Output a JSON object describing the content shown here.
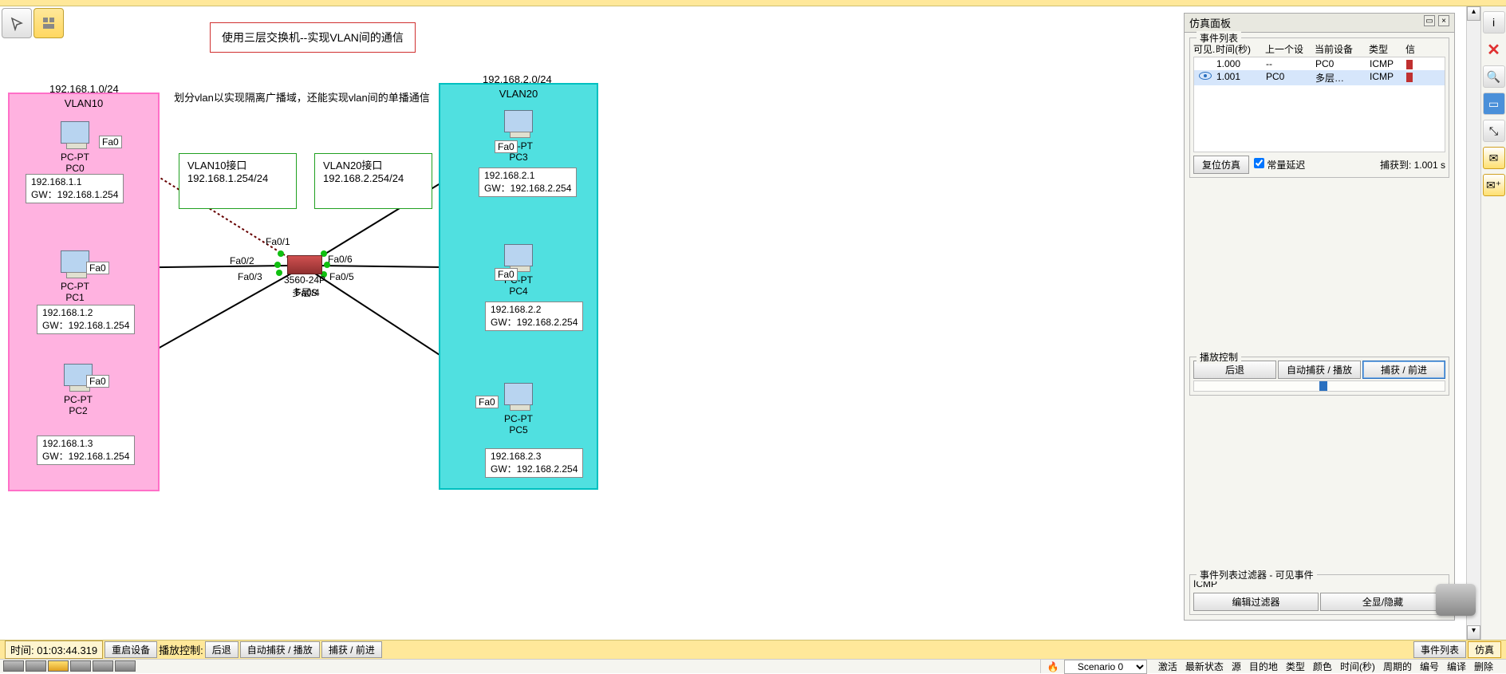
{
  "sim_panel": {
    "title": "仿真面板",
    "event_list_title": "事件列表",
    "headers": {
      "visible": "可见.",
      "time": "时间(秒)",
      "last_dev": "上一个设",
      "cur_dev": "当前设备",
      "type": "类型",
      "info": "信"
    },
    "rows": [
      {
        "time": "1.000",
        "last": "--",
        "cur": "PC0",
        "type": "ICMP",
        "color": "#c03030"
      },
      {
        "time": "1.001",
        "last": "PC0",
        "cur": "多层…",
        "type": "ICMP",
        "color": "#c03030"
      }
    ],
    "reset_btn": "复位仿真",
    "const_delay": "常量延迟",
    "captured": "捕获到: 1.001 s",
    "play_title": "播放控制",
    "back_btn": "后退",
    "auto_btn": "自动捕获 / 播放",
    "fwd_btn": "捕获 / 前进",
    "filter_title": "事件列表过滤器 - 可见事件",
    "filter_text": "ICMP",
    "edit_filter": "编辑过滤器",
    "show_hide": "全显/隐藏"
  },
  "notes": {
    "red_box": "使用三层交换机--实现VLAN间的通信",
    "desc": "划分vlan以实现隔离广播域，还能实现vlan间的单播通信"
  },
  "subnets": {
    "left": "192.168.1.0/24",
    "right": "192.168.2.0/24"
  },
  "vlan1_label": "VLAN10",
  "vlan2_label": "VLAN20",
  "if_boxes": {
    "left": {
      "title": "VLAN10接口",
      "ip": "192.168.1.254/24"
    },
    "right": {
      "title": "VLAN20接口",
      "ip": "192.168.2.254/24"
    }
  },
  "switch": {
    "model": "3560-24P",
    "name": "多层S",
    "ports": {
      "f01": "Fa0/1",
      "f02": "Fa0/2",
      "f03": "Fa0/3",
      "f04": "Fa0/4",
      "f05": "Fa0/5",
      "f06": "Fa0/6"
    }
  },
  "pcs": {
    "pc0": {
      "name": "PC-PT",
      "host": "PC0",
      "ip": "192.168.1.1",
      "gw": "GW：192.168.1.254",
      "port": "Fa0"
    },
    "pc1": {
      "name": "PC-PT",
      "host": "PC1",
      "ip": "192.168.1.2",
      "gw": "GW：192.168.1.254",
      "port": "Fa0"
    },
    "pc2": {
      "name": "PC-PT",
      "host": "PC2",
      "ip": "192.168.1.3",
      "gw": "GW：192.168.1.254",
      "port": "Fa0"
    },
    "pc3": {
      "name": "PC-PT",
      "host": "PC3",
      "ip": "192.168.2.1",
      "gw": "GW：192.168.2.254",
      "port": "Fa0"
    },
    "pc4": {
      "name": "PC-PT",
      "host": "PC4",
      "ip": "192.168.2.2",
      "gw": "GW：192.168.2.254",
      "port": "Fa0"
    },
    "pc5": {
      "name": "PC-PT",
      "host": "PC5",
      "ip": "192.168.2.3",
      "gw": "GW：192.168.2.254",
      "port": "Fa0"
    }
  },
  "status": {
    "time_label": "时间: 01:03:44.319",
    "reboot": "重启设备",
    "play_label": "播放控制:",
    "back": "后退",
    "auto": "自动捕获 / 播放",
    "fwd": "捕获 / 前进",
    "eventlist": "事件列表",
    "sim": "仿真"
  },
  "scenario": {
    "label": "Scenario 0",
    "headers": [
      "激活",
      "最新状态",
      "源",
      "目的地",
      "类型",
      "颜色",
      "时间(秒)",
      "周期的",
      "编号",
      "编译",
      "删除"
    ]
  }
}
